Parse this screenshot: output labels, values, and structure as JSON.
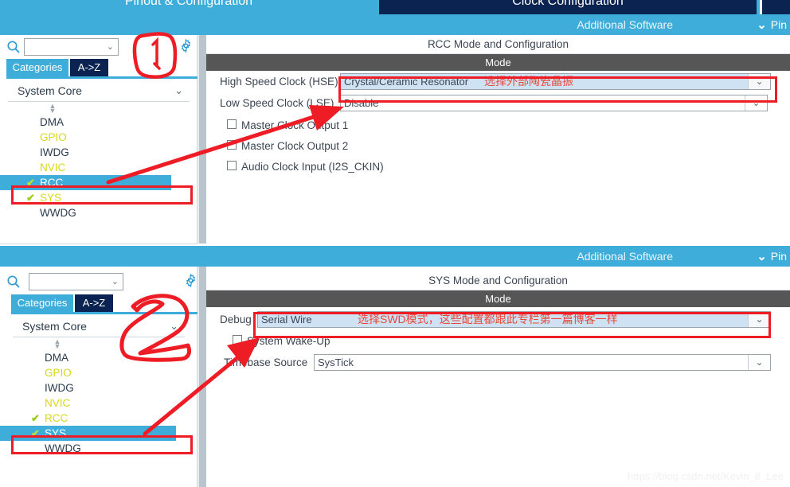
{
  "app": {
    "tabs": [
      {
        "label": "Pinout & Configuration",
        "active": true
      },
      {
        "label": "Clock Configuration",
        "active": false
      }
    ],
    "additional_software": "Additional Software",
    "pinout_menu": "Pin",
    "chevron": "⌄",
    "watermark": "https://blog.csdn.net/Kevin_8_Lee"
  },
  "panels": [
    {
      "id": "rcc",
      "search": {
        "value": "",
        "placeholder": "",
        "icon": "search-icon",
        "dropdown_arrow": "⌄"
      },
      "gear": "gear-icon",
      "tabs": [
        {
          "label": "Categories",
          "active": true
        },
        {
          "label": "A->Z",
          "active": false
        }
      ],
      "group": {
        "label": "System Core",
        "chevron": "⌄"
      },
      "tree_items": [
        {
          "label": "DMA",
          "state": "normal",
          "checked": false
        },
        {
          "label": "GPIO",
          "state": "configured",
          "checked": false
        },
        {
          "label": "IWDG",
          "state": "normal",
          "checked": false
        },
        {
          "label": "NVIC",
          "state": "configured",
          "checked": false
        },
        {
          "label": "RCC",
          "state": "configured",
          "checked": true,
          "selected": true
        },
        {
          "label": "SYS",
          "state": "configured",
          "checked": true,
          "selected": false
        },
        {
          "label": "WWDG",
          "state": "normal",
          "checked": false
        }
      ],
      "config_title": "RCC Mode and Configuration",
      "mode_header": "Mode",
      "rows": [
        {
          "type": "combo",
          "label": "High Speed Clock (HSE)",
          "value": "Crystal/Ceramic Resonator",
          "note": "选择外部陶瓷晶振",
          "highlight": true,
          "arrow": "⌄"
        },
        {
          "type": "combo",
          "label": "Low Speed Clock (LSE)",
          "value": "Disable",
          "note": "",
          "highlight": false,
          "arrow": "⌄"
        },
        {
          "type": "checkbox",
          "label": "Master Clock Output 1",
          "checked": false
        },
        {
          "type": "checkbox",
          "label": "Master Clock Output 2",
          "checked": false
        },
        {
          "type": "checkbox",
          "label": "Audio Clock Input (I2S_CKIN)",
          "checked": false
        }
      ],
      "annotation_number": "1"
    },
    {
      "id": "sys",
      "search": {
        "value": "",
        "placeholder": "",
        "icon": "search-icon",
        "dropdown_arrow": "⌄"
      },
      "gear": "gear-icon",
      "tabs": [
        {
          "label": "Categories",
          "active": true
        },
        {
          "label": "A->Z",
          "active": false
        }
      ],
      "group": {
        "label": "System Core",
        "chevron": "⌄"
      },
      "tree_items": [
        {
          "label": "DMA",
          "state": "normal",
          "checked": false
        },
        {
          "label": "GPIO",
          "state": "configured",
          "checked": false
        },
        {
          "label": "IWDG",
          "state": "normal",
          "checked": false
        },
        {
          "label": "NVIC",
          "state": "configured",
          "checked": false
        },
        {
          "label": "RCC",
          "state": "configured",
          "checked": true,
          "selected": false
        },
        {
          "label": "SYS",
          "state": "configured",
          "checked": true,
          "selected": true
        },
        {
          "label": "WWDG",
          "state": "normal",
          "checked": false
        }
      ],
      "config_title": "SYS Mode and Configuration",
      "mode_header": "Mode",
      "rows": [
        {
          "type": "combo",
          "label": "Debug",
          "value": "Serial Wire",
          "note": "选择SWD模式，这些配置都跟此专栏第一篇博客一样",
          "highlight": true,
          "arrow": "⌄"
        },
        {
          "type": "checkbox",
          "label": "System Wake-Up",
          "checked": false
        },
        {
          "type": "combo",
          "label": "Timebase Source",
          "value": "SysTick",
          "note": "",
          "highlight": false,
          "arrow": "⌄"
        }
      ],
      "annotation_number": "2"
    }
  ]
}
